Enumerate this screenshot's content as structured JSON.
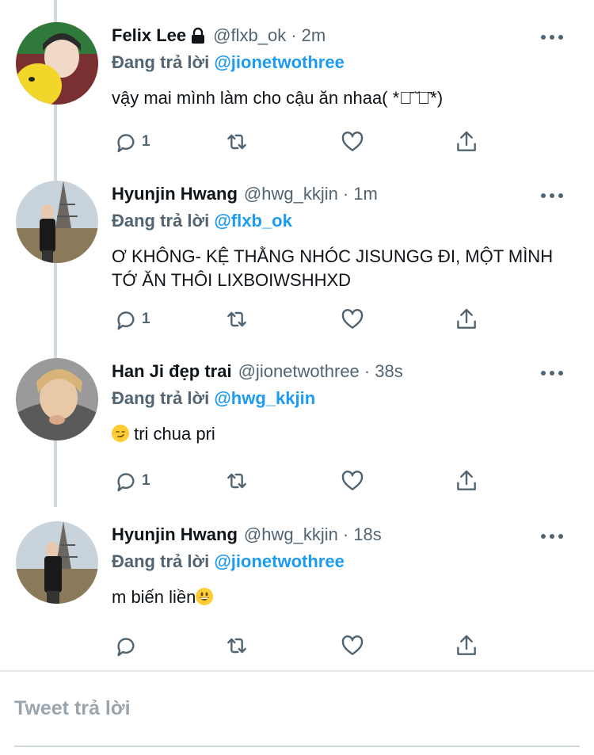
{
  "tweets": [
    {
      "name": "Felix Lee",
      "handle": "@flxb_ok",
      "time": "· 2m",
      "reply_label": "Đang trả lời",
      "reply_handle": "@jionetwothree",
      "text": "vậy mai mình làm cho cậu ăn nhaa( *ค̄ ̆ค̄*)",
      "reply_count": "1",
      "protected": true
    },
    {
      "name": "Hyunjin Hwang",
      "handle": "@hwg_kkjin",
      "time": "· 1m",
      "reply_label": "Đang trả lời",
      "reply_handle": "@flxb_ok",
      "text": "Ơ KHÔNG- KỆ THẰNG NHÓC JISUNGG ĐI, MỘT MÌNH TỚ ĂN THÔI LIXBOIWSHHXD",
      "reply_count": "1"
    },
    {
      "name": "Han Ji đẹp trai",
      "handle": "@jionetwothree",
      "time": "· 38s",
      "reply_label": "Đang trả lời",
      "reply_handle": "@hwg_kkjin",
      "text": " tri chua pri",
      "reply_count": "1",
      "emoji": "smirk"
    },
    {
      "name": "Hyunjin Hwang",
      "handle": "@hwg_kkjin",
      "time": "· 18s",
      "reply_label": "Đang trả lời",
      "reply_handle": "@jionetwothree",
      "text": "m biến liền",
      "reply_count": "",
      "emoji": "grin"
    }
  ],
  "compose": {
    "placeholder": "Tweet trả lời"
  },
  "icons": {
    "reply": "reply-icon",
    "retweet": "retweet-icon",
    "like": "like-icon",
    "share": "share-icon",
    "more": "more-icon",
    "lock": "lock-icon"
  },
  "colors": {
    "link": "#1d9bf0",
    "secondary": "#536471",
    "thread_line": "#cfd9de",
    "placeholder": "#9aa5ad"
  }
}
